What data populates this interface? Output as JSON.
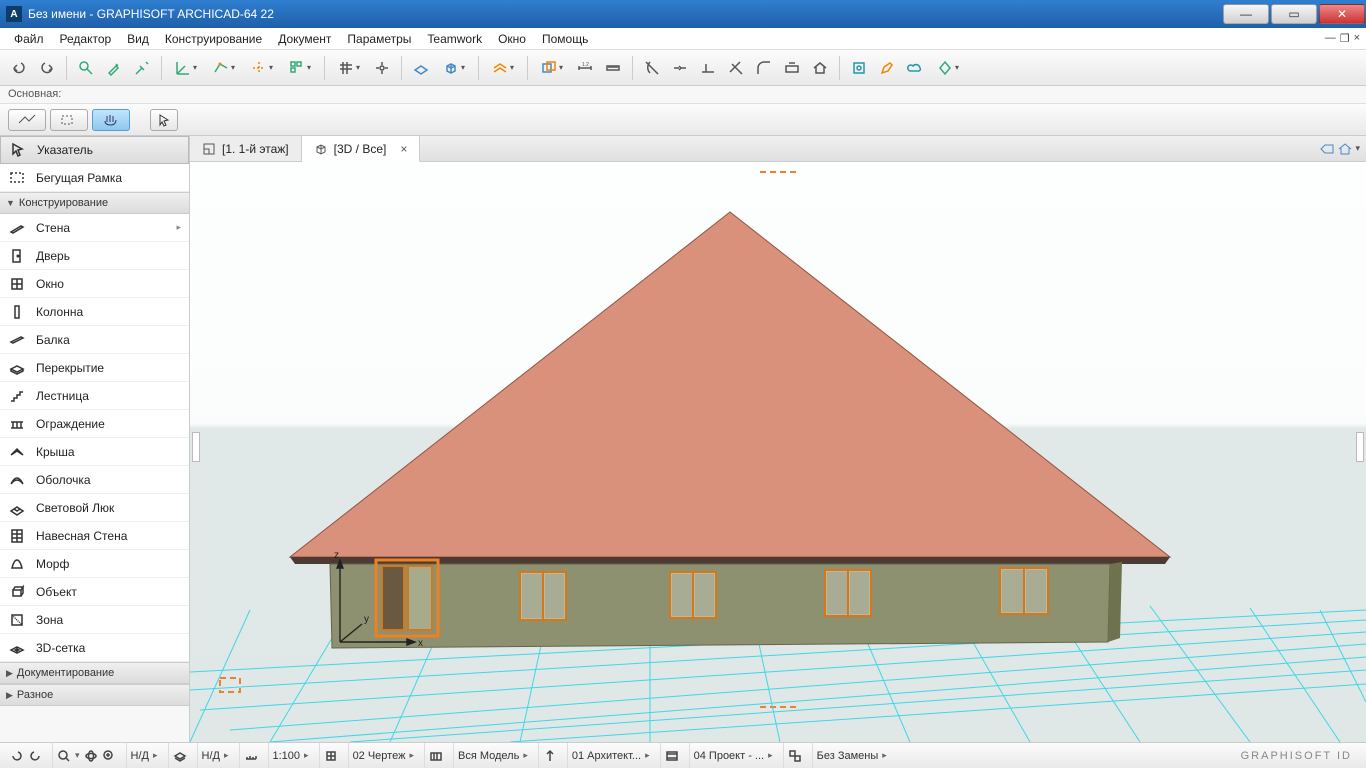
{
  "title": "Без имени - GRAPHISOFT ARCHICAD-64 22",
  "menu": [
    "Файл",
    "Редактор",
    "Вид",
    "Конструирование",
    "Документ",
    "Параметры",
    "Teamwork",
    "Окно",
    "Помощь"
  ],
  "sublabel": "Основная:",
  "tabs": [
    {
      "label": "[1. 1-й этаж]",
      "active": false
    },
    {
      "label": "[3D / Все]",
      "active": true
    }
  ],
  "toolbox": {
    "top": [
      {
        "key": "pointer",
        "label": "Указатель",
        "selected": true
      },
      {
        "key": "marquee",
        "label": "Бегущая Рамка",
        "selected": false
      }
    ],
    "sections": [
      {
        "title": "Конструирование",
        "open": true,
        "items": [
          {
            "key": "wall",
            "label": "Стена"
          },
          {
            "key": "door",
            "label": "Дверь"
          },
          {
            "key": "window",
            "label": "Окно"
          },
          {
            "key": "column",
            "label": "Колонна"
          },
          {
            "key": "beam",
            "label": "Балка"
          },
          {
            "key": "slab",
            "label": "Перекрытие"
          },
          {
            "key": "stair",
            "label": "Лестница"
          },
          {
            "key": "railing",
            "label": "Ограждение"
          },
          {
            "key": "roof",
            "label": "Крыша"
          },
          {
            "key": "shell",
            "label": "Оболочка"
          },
          {
            "key": "skylight",
            "label": "Световой Люк"
          },
          {
            "key": "curtainwall",
            "label": "Навесная Стена"
          },
          {
            "key": "morph",
            "label": "Морф"
          },
          {
            "key": "object",
            "label": "Объект"
          },
          {
            "key": "zone",
            "label": "Зона"
          },
          {
            "key": "mesh",
            "label": "3D-сетка"
          }
        ]
      },
      {
        "title": "Документирование",
        "open": false,
        "items": []
      },
      {
        "title": "Разное",
        "open": false,
        "items": []
      }
    ]
  },
  "status": {
    "nd1": "Н/Д",
    "nd2": "Н/Д",
    "scale": "1:100",
    "drawing": "02 Чертеж",
    "model": "Вся Модель",
    "arch": "01 Архитект...",
    "project": "04 Проект - ...",
    "replace": "Без Замены",
    "brand": "GRAPHISOFT ID"
  },
  "axes": {
    "x": "x",
    "y": "y",
    "z": "z"
  }
}
